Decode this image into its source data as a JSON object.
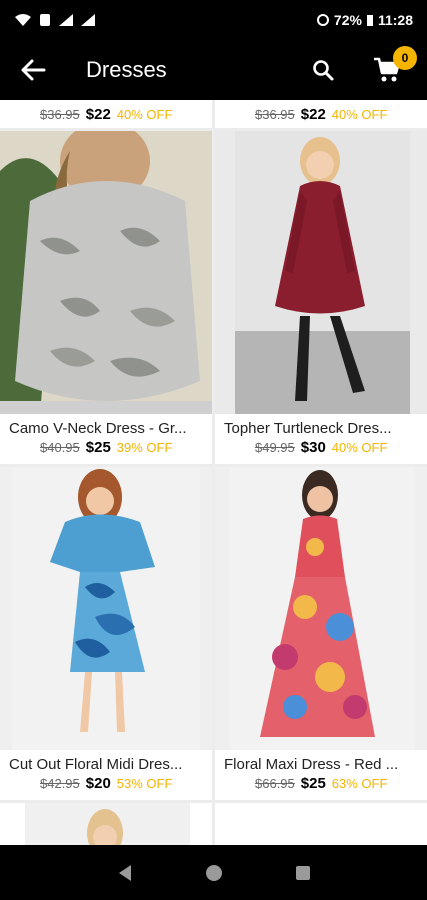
{
  "status_bar": {
    "battery": "72%",
    "time": "11:28"
  },
  "app_bar": {
    "title": "Dresses",
    "cart_count": "0"
  },
  "top_row": [
    {
      "old_price": "$36.95",
      "price": "$22",
      "off": "40% OFF"
    },
    {
      "old_price": "$36.95",
      "price": "$22",
      "off": "40% OFF"
    }
  ],
  "products": [
    {
      "name": "Camo V-Neck Dress - Gr...",
      "old_price": "$40.95",
      "price": "$25",
      "off": "39% OFF"
    },
    {
      "name": "Topher Turtleneck Dres...",
      "old_price": "$49.95",
      "price": "$30",
      "off": "40% OFF"
    },
    {
      "name": "Cut Out Floral Midi Dres...",
      "old_price": "$42.95",
      "price": "$20",
      "off": "53% OFF"
    },
    {
      "name": "Floral Maxi Dress - Red ...",
      "old_price": "$66.95",
      "price": "$25",
      "off": "63% OFF"
    }
  ],
  "colors": {
    "accent": "#f5b400",
    "bar": "#000000"
  },
  "icons": [
    "back-arrow-icon",
    "search-icon",
    "cart-icon",
    "nav-back-icon",
    "nav-home-icon",
    "nav-recents-icon"
  ]
}
